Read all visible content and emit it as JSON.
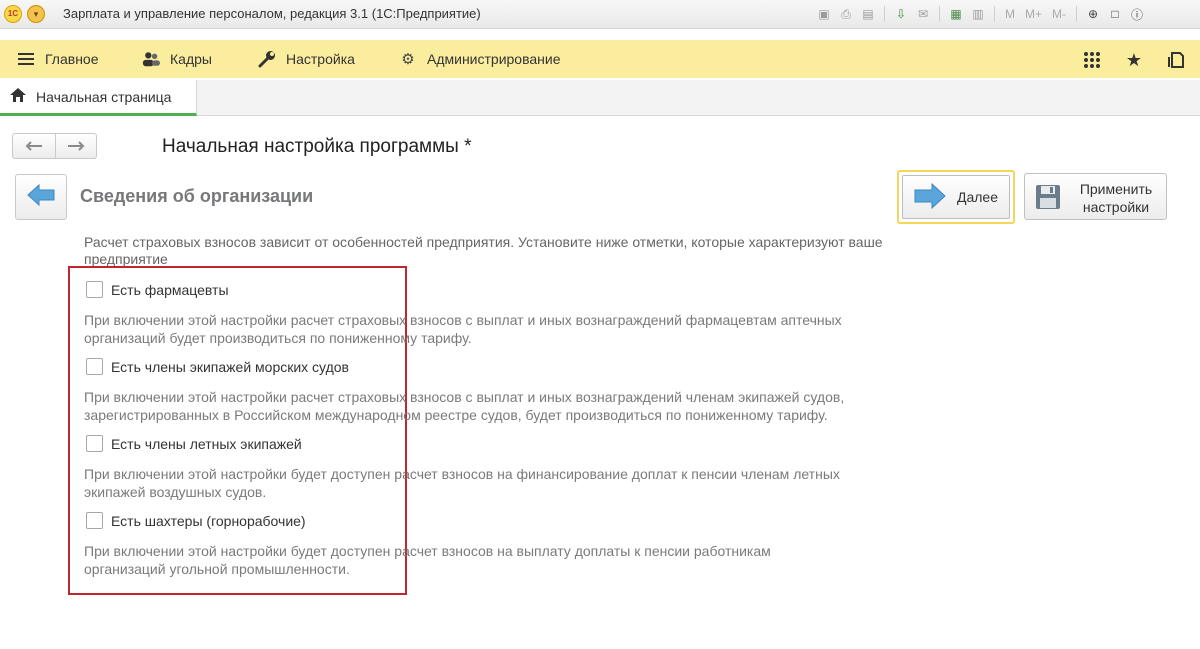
{
  "window": {
    "title": "Зарплата и управление персоналом, редакция 3.1  (1С:Предприятие)",
    "logo_text": "1С",
    "toolbar_text": [
      "M",
      "M+",
      "M-"
    ]
  },
  "sections": {
    "items": [
      {
        "label": "Главное",
        "icon": "hamburger-icon"
      },
      {
        "label": "Кадры",
        "icon": "people-icon"
      },
      {
        "label": "Настройка",
        "icon": "wrench-icon"
      },
      {
        "label": "Администрирование",
        "icon": "gear-icon"
      }
    ],
    "tools": [
      "apps-grid-icon",
      "star-icon",
      "history-icon"
    ]
  },
  "tabs": {
    "home_label": "Начальная страница"
  },
  "page": {
    "title": "Начальная настройка программы *"
  },
  "step": {
    "title": "Сведения об организации",
    "next_label": "Далее",
    "apply_label_line1": "Применить",
    "apply_label_line2": "настройки"
  },
  "content": {
    "intro": "Расчет страховых взносов зависит от особенностей предприятия. Установите ниже отметки, которые характеризуют ваше предприятие",
    "options": [
      {
        "label": "Есть фармацевты",
        "checked": false,
        "desc_line1": "При включении этой настройки расчет страховых взносов с выплат и иных вознаграждений фармацевтам аптечных",
        "desc_line2": "организаций будет производиться по пониженному тарифу."
      },
      {
        "label": "Есть члены экипажей морских судов",
        "checked": false,
        "desc_line1": "При включении этой настройки расчет страховых взносов с выплат и иных вознаграждений членам экипажей судов,",
        "desc_line2": "зарегистрированных в Российском международном реестре судов, будет производиться по пониженному тарифу."
      },
      {
        "label": "Есть члены летных экипажей",
        "checked": false,
        "desc_line1": "При включении этой настройки будет доступен расчет взносов на финансирование доплат к пенсии членам летных",
        "desc_line2": "экипажей воздушных судов."
      },
      {
        "label": "Есть шахтеры (горнорабочие)",
        "checked": false,
        "desc_line1": "При включении этой настройки будет доступен расчет взносов на выплату доплаты к пенсии работникам",
        "desc_line2": "организаций угольной промышленности."
      }
    ]
  },
  "colors": {
    "section_bar": "#fbed9e",
    "tab_active_underline": "#4caf50",
    "highlight": "#c0262d",
    "next_focus": "#f5d55a",
    "step_title": "#77787a"
  }
}
